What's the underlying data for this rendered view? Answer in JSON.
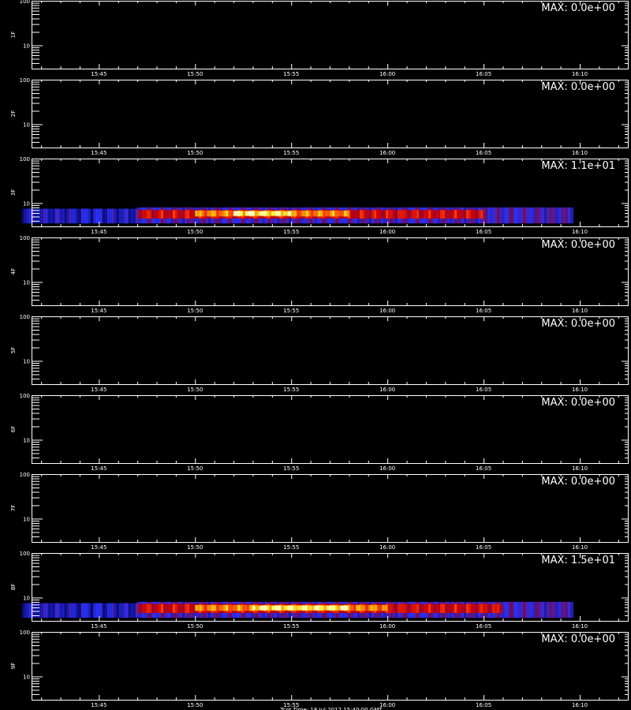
{
  "colors": {
    "background": "#000000",
    "axis": "#ffffff",
    "colormap": [
      "#000000",
      "#1a1aa6",
      "#3030ff",
      "#8a0a40",
      "#d00000",
      "#ff2a00",
      "#ff9a00",
      "#ffff40",
      "#ffffc0"
    ]
  },
  "chart_data": {
    "type": "heatmap",
    "panel_labels": [
      "1F",
      "2F",
      "3F",
      "4F",
      "5F",
      "6F",
      "7F",
      "8F",
      "9F"
    ],
    "max_labels": [
      "MAX: 0.0e+00",
      "MAX: 0.0e+00",
      "MAX: 1.1e+01",
      "MAX: 0.0e+00",
      "MAX: 0.0e+00",
      "MAX: 0.0e+00",
      "MAX: 0.0e+00",
      "MAX: 1.5e+01",
      "MAX: 0.0e+00"
    ],
    "y_scale": "log",
    "ylim": [
      3,
      100
    ],
    "y_ticks": [
      "100",
      "10"
    ],
    "x_tick_labels": [
      "15:45",
      "15:50",
      "15:55",
      "16:00",
      "16:05",
      "16:10"
    ],
    "x_range_minutes": [
      "15:41",
      "16:12"
    ],
    "data_end_time": "16:09:40",
    "activity": [
      {
        "panel": "3F",
        "max": 11,
        "bands": [
          {
            "t_start": "15:41",
            "t_end": "15:47",
            "y_low": 3.5,
            "y_high": 7.5,
            "level": 0.25
          },
          {
            "t_start": "15:47",
            "t_end": "16:09:40",
            "y_low": 3.5,
            "y_high": 8.0,
            "level": 0.35
          },
          {
            "t_start": "15:47",
            "t_end": "16:05",
            "y_low": 4.5,
            "y_high": 7.0,
            "level": 0.6
          },
          {
            "t_start": "15:50",
            "t_end": "15:58",
            "y_low": 5.0,
            "y_high": 6.8,
            "level": 0.8
          },
          {
            "t_start": "15:52",
            "t_end": "15:55",
            "y_low": 5.2,
            "y_high": 6.6,
            "level": 0.95
          }
        ]
      },
      {
        "panel": "8F",
        "max": 15,
        "bands": [
          {
            "t_start": "15:41",
            "t_end": "15:47",
            "y_low": 3.5,
            "y_high": 7.5,
            "level": 0.25
          },
          {
            "t_start": "15:47",
            "t_end": "16:09:40",
            "y_low": 3.5,
            "y_high": 8.0,
            "level": 0.35
          },
          {
            "t_start": "15:47",
            "t_end": "16:06",
            "y_low": 4.5,
            "y_high": 7.2,
            "level": 0.6
          },
          {
            "t_start": "15:50",
            "t_end": "16:00",
            "y_low": 5.0,
            "y_high": 6.8,
            "level": 0.8
          },
          {
            "t_start": "15:53",
            "t_end": "15:58",
            "y_low": 5.2,
            "y_high": 6.6,
            "level": 0.95
          }
        ]
      }
    ]
  },
  "footer": {
    "text": "Tcnt Time: 18 Jul 2012 15:40:00 GMT"
  }
}
